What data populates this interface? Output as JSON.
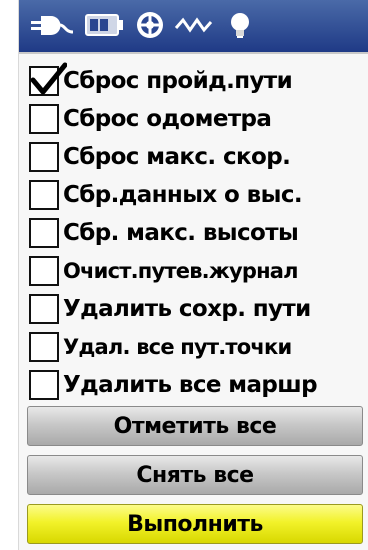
{
  "statusbar": {
    "icons": [
      "power-plug-icon",
      "battery-icon",
      "satellite-icon",
      "signal-wave-icon",
      "backlight-bulb-icon"
    ],
    "colors": {
      "background": "#2a4690",
      "icon": "#ffffff"
    }
  },
  "reset_options": [
    {
      "label": "Сброс пройд.пути",
      "checked": true
    },
    {
      "label": "Сброс одометра",
      "checked": false
    },
    {
      "label": "Сброс макс. скор.",
      "checked": false
    },
    {
      "label": "Сбр.данных о выс.",
      "checked": false
    },
    {
      "label": "Сбр. макс. высоты",
      "checked": false
    },
    {
      "label": "Очист.путев.журнал",
      "checked": false
    },
    {
      "label": "Удалить сохр. пути",
      "checked": false
    },
    {
      "label": "Удал. все пут.точки",
      "checked": false
    },
    {
      "label": "Удалить все маршр",
      "checked": false
    }
  ],
  "buttons": {
    "select_all": "Отметить все",
    "deselect_all": "Снять все",
    "apply": "Выполнить"
  },
  "colors": {
    "apply_button": "#f2f22a",
    "secondary_button": "#c8c8c8"
  }
}
